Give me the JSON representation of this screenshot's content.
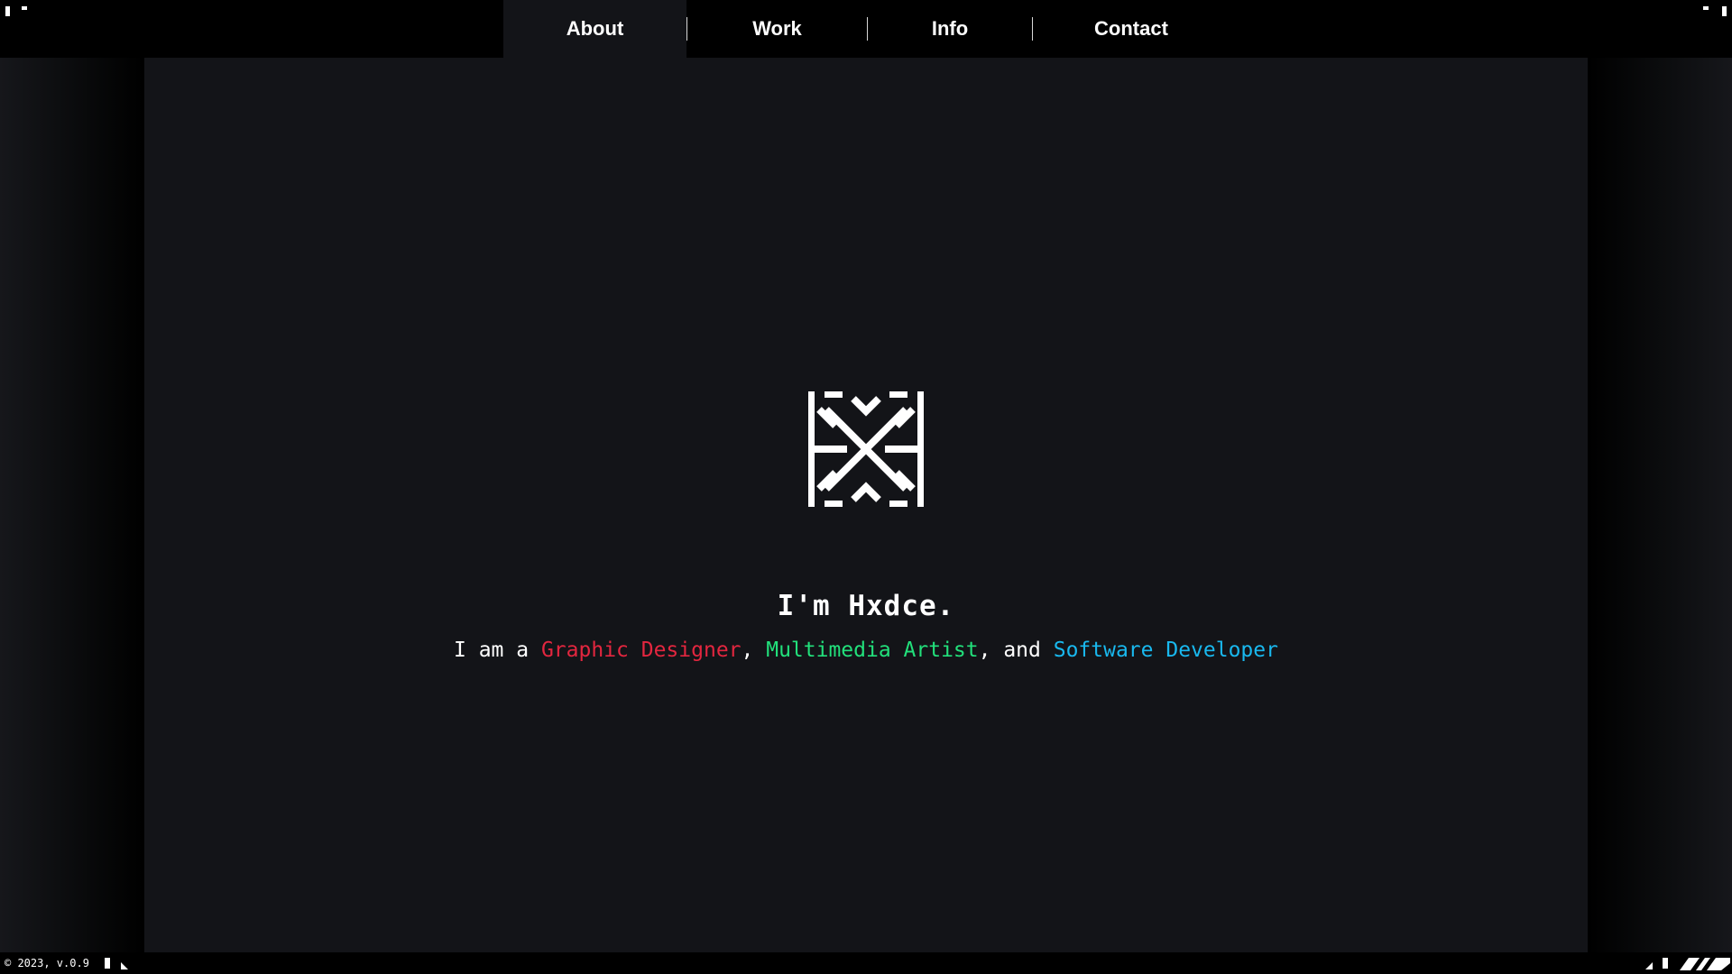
{
  "nav": {
    "items": [
      {
        "label": "About",
        "active": true
      },
      {
        "label": "Work",
        "active": false
      },
      {
        "label": "Info",
        "active": false
      },
      {
        "label": "Contact",
        "active": false
      }
    ]
  },
  "hero": {
    "logo_icon": "hxdce-logo-icon",
    "title": "I'm Hxdce.",
    "subtitle": {
      "prefix": "I am a ",
      "role_1": "Graphic Designer",
      "sep_1": ", ",
      "role_2": "Multimedia Artist",
      "sep_2": ", and ",
      "role_3": "Software Developer"
    }
  },
  "footer": {
    "text": "© 2023, v.0.9"
  },
  "colors": {
    "background": "#131418",
    "role_1": "#e3263f",
    "role_2": "#22e07b",
    "role_3": "#19b8ee"
  }
}
